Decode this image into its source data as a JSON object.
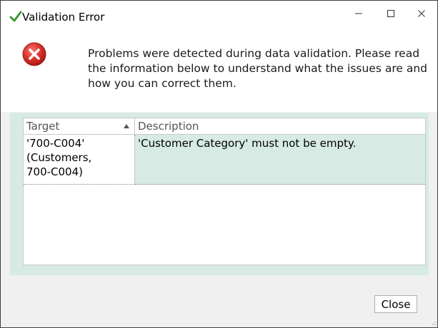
{
  "window": {
    "title": "Validation Error",
    "controls": {
      "minimize": "–",
      "maximize": "☐",
      "close": "✕"
    }
  },
  "header": {
    "icon": "error-icon",
    "message": "Problems were detected during data validation. Please read the information below to understand what the issues are and how you can correct them."
  },
  "grid": {
    "columns": [
      "Target",
      "Description"
    ],
    "sort_column": "Target",
    "sort_direction": "ascending",
    "rows": [
      {
        "target": "'700-C004'\n(Customers,\n700-C004)",
        "description": "'Customer Category' must not be empty."
      }
    ]
  },
  "footer": {
    "close_label": "Close"
  },
  "colors": {
    "accent_row": "#d7ebe4",
    "error_red": "#d9302b",
    "check_green": "#3a9a3a"
  }
}
